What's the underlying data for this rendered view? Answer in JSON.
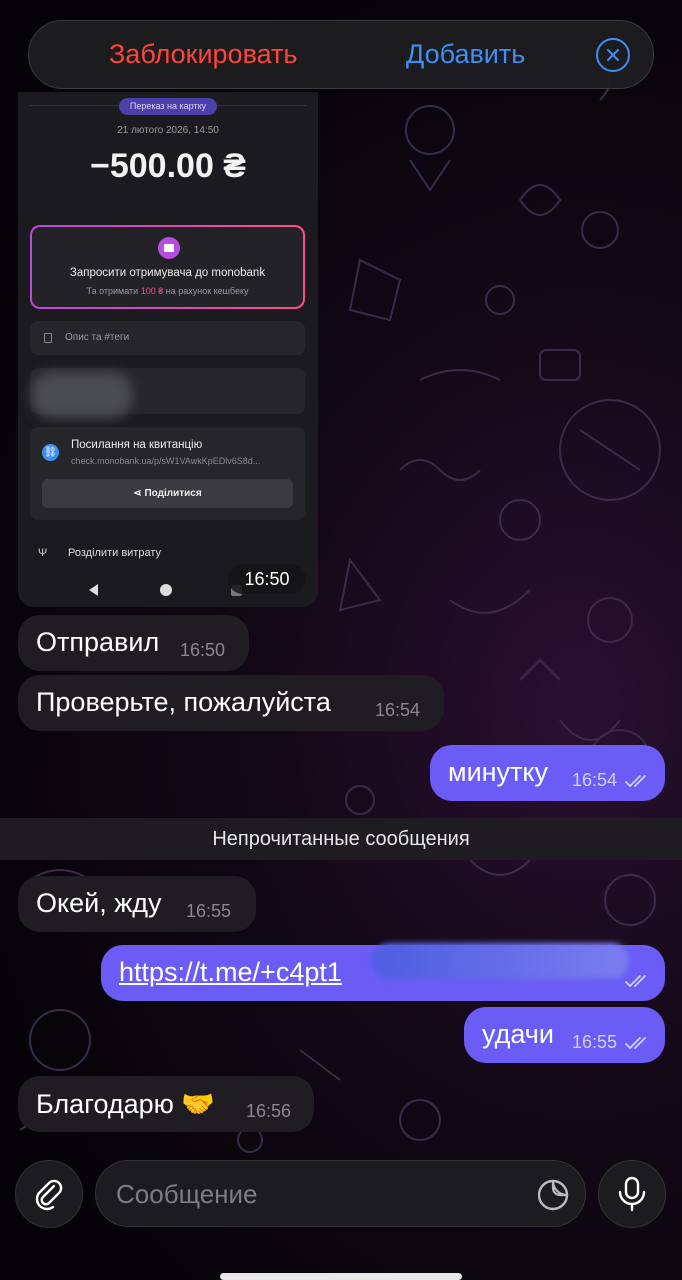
{
  "top_bar": {
    "block_label": "Заблокировать",
    "add_label": "Добавить",
    "colors": {
      "block": "#ff453a",
      "add": "#3d8ef5"
    }
  },
  "image_message": {
    "chip": "Переказ на картку",
    "date": "21 лютого 2026, 14:50",
    "amount": "−500.00 ₴",
    "invite_title": "Запросити отримувача до monobank",
    "invite_sub_prefix": "Та отримати ",
    "invite_sub_bonus": "100 ₴",
    "invite_sub_suffix": " на рахунок кешбеку",
    "description_placeholder": "Опис та #теги",
    "receipt_title": "Посилання на квитанцію",
    "receipt_url": "check.monobank.ua/p/sW1VAwkKpEDlv6S8d...",
    "share_label": "Поділитися",
    "split_label": "Розділити витрату",
    "time": "16:50"
  },
  "messages": [
    {
      "dir": "in",
      "text": "Отправил",
      "time": "16:50"
    },
    {
      "dir": "in",
      "text": "Проверьте, пожалуйста",
      "time": "16:54"
    },
    {
      "dir": "out",
      "text": "минутку",
      "time": "16:54"
    },
    {
      "dir": "in",
      "text": "Окей, жду",
      "time": "16:55"
    },
    {
      "dir": "out",
      "text": "https://t.me/+c4pt1",
      "time": "",
      "link": true
    },
    {
      "dir": "out",
      "text": "удачи",
      "time": "16:55"
    },
    {
      "dir": "in",
      "text": "Благодарю 🤝",
      "time": "16:56"
    }
  ],
  "unread_divider": "Непрочитанные сообщения",
  "composer": {
    "placeholder": "Сообщение",
    "attach_icon": "paperclip-icon",
    "sticker_icon": "sticker-icon",
    "mic_icon": "microphone-icon"
  },
  "colors": {
    "outgoing_bubble": "#6b5cf5",
    "incoming_bubble": "#1f1c24",
    "background": "#050308"
  }
}
